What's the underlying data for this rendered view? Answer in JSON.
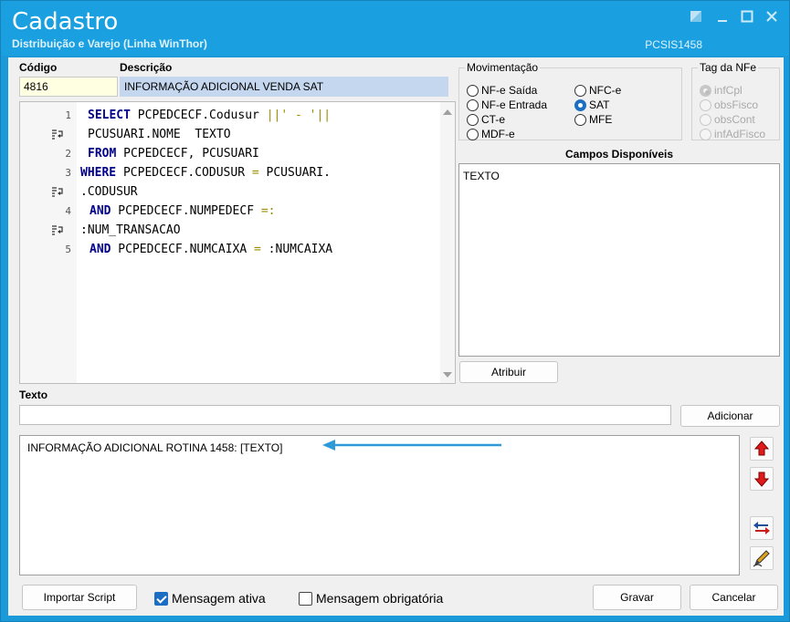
{
  "window": {
    "title": "Cadastro",
    "subtitle": "Distribuição e Varejo (Linha WinThor)",
    "code": "PCSIS1458"
  },
  "form": {
    "codigo_label": "Código",
    "codigo_value": "4816",
    "descricao_label": "Descrição",
    "descricao_value": "INFORMAÇÃO ADICIONAL VENDA SAT"
  },
  "editor": {
    "lines": [
      {
        "num": "1",
        "parts": [
          {
            "t": "kw",
            "v": "SELECT"
          },
          {
            "t": "tx",
            "v": " PCPEDCECF.Codusur "
          },
          {
            "t": "op",
            "v": "||' - '||"
          }
        ]
      },
      {
        "num": "",
        "parts": [
          {
            "t": "tx",
            "v": "PCUSUARI.NOME  TEXTO"
          }
        ]
      },
      {
        "num": "2",
        "parts": [
          {
            "t": "kw",
            "v": "FROM"
          },
          {
            "t": "tx",
            "v": " PCPEDCECF, PCUSUARI"
          }
        ]
      },
      {
        "num": "3",
        "parts": [
          {
            "t": "kw",
            "v": "WHERE"
          },
          {
            "t": "tx",
            "v": " PCPEDCECF.CODUSUR "
          },
          {
            "t": "op",
            "v": "="
          },
          {
            "t": "tx",
            "v": " PCUSUARI."
          }
        ]
      },
      {
        "num": "",
        "parts": [
          {
            "t": "tx",
            "v": ".CODUSUR"
          }
        ]
      },
      {
        "num": "4",
        "parts": [
          {
            "t": "kw",
            "v": "AND"
          },
          {
            "t": "tx",
            "v": " PCPEDCECF.NUMPEDECF "
          },
          {
            "t": "op",
            "v": "=:"
          }
        ]
      },
      {
        "num": "",
        "parts": [
          {
            "t": "tx",
            "v": ":NUM_TRANSACAO"
          }
        ]
      },
      {
        "num": "5",
        "parts": [
          {
            "t": "kw",
            "v": "AND"
          },
          {
            "t": "tx",
            "v": " PCPEDCECF.NUMCAIXA "
          },
          {
            "t": "op",
            "v": "="
          },
          {
            "t": "tx",
            "v": " :NUMCAIXA"
          }
        ]
      }
    ]
  },
  "movimentacao": {
    "label": "Movimentação",
    "options": [
      "NF-e Saída",
      "NF-e Entrada",
      "CT-e",
      "MDF-e",
      "NFC-e",
      "SAT",
      "MFE"
    ],
    "selected": "SAT"
  },
  "tag_nfe": {
    "label": "Tag da NFe",
    "options": [
      "infCpl",
      "obsFisco",
      "obsCont",
      "infAdFisco"
    ],
    "selected": "infCpl"
  },
  "campos": {
    "title": "Campos Disponíveis",
    "items": [
      "TEXTO"
    ],
    "atribuir_label": "Atribuir"
  },
  "texto": {
    "label": "Texto",
    "value": "",
    "adicionar_label": "Adicionar",
    "messages": [
      "INFORMAÇÃO ADICIONAL ROTINA 1458: [TEXTO]"
    ]
  },
  "footer": {
    "importar_label": "Importar Script",
    "mensagem_ativa_label": "Mensagem ativa",
    "mensagem_ativa_checked": true,
    "mensagem_obrigatoria_label": "Mensagem obrigatória",
    "mensagem_obrigatoria_checked": false,
    "gravar_label": "Gravar",
    "cancelar_label": "Cancelar"
  },
  "colors": {
    "title_bar": "#1aa0e0",
    "accent": "#1b6ec2",
    "keyword": "#00008b",
    "operator": "#9b8e00",
    "arrow": "#2e9ad8"
  }
}
